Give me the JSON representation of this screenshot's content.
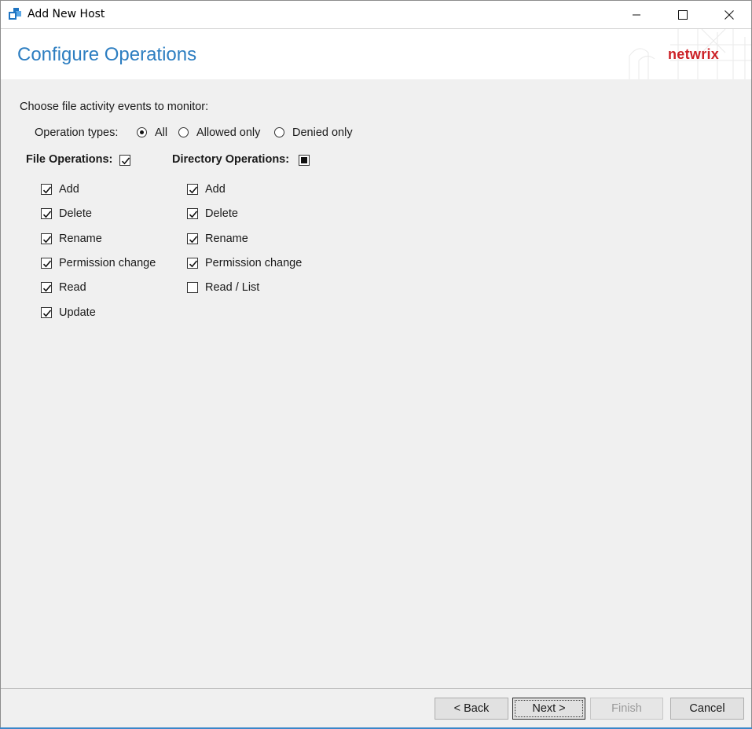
{
  "window": {
    "title": "Add New Host",
    "controls": {
      "minimize": "minimize-icon",
      "maximize": "maximize-icon",
      "close": "close-icon"
    }
  },
  "header": {
    "page_title": "Configure Operations",
    "logo_text": "netwrix",
    "title_color": "#2d7ec1",
    "logo_color": "#cc2127"
  },
  "content": {
    "intro": "Choose file activity events to monitor:",
    "operation_types": {
      "label": "Operation types:",
      "options": [
        {
          "label": "All",
          "selected": true
        },
        {
          "label": "Allowed only",
          "selected": false
        },
        {
          "label": "Denied only",
          "selected": false
        }
      ]
    },
    "file_operations": {
      "label": "File Operations:",
      "state": "checked",
      "items": [
        {
          "label": "Add",
          "checked": true
        },
        {
          "label": "Delete",
          "checked": true
        },
        {
          "label": "Rename",
          "checked": true
        },
        {
          "label": "Permission change",
          "checked": true
        },
        {
          "label": "Read",
          "checked": true
        },
        {
          "label": "Update",
          "checked": true
        }
      ]
    },
    "directory_operations": {
      "label": "Directory Operations:",
      "state": "indeterminate",
      "items": [
        {
          "label": "Add",
          "checked": true
        },
        {
          "label": "Delete",
          "checked": true
        },
        {
          "label": "Rename",
          "checked": true
        },
        {
          "label": "Permission change",
          "checked": true
        },
        {
          "label": "Read / List",
          "checked": false
        }
      ]
    }
  },
  "footer": {
    "back": "< Back",
    "next": "Next >",
    "finish": "Finish",
    "cancel": "Cancel"
  }
}
